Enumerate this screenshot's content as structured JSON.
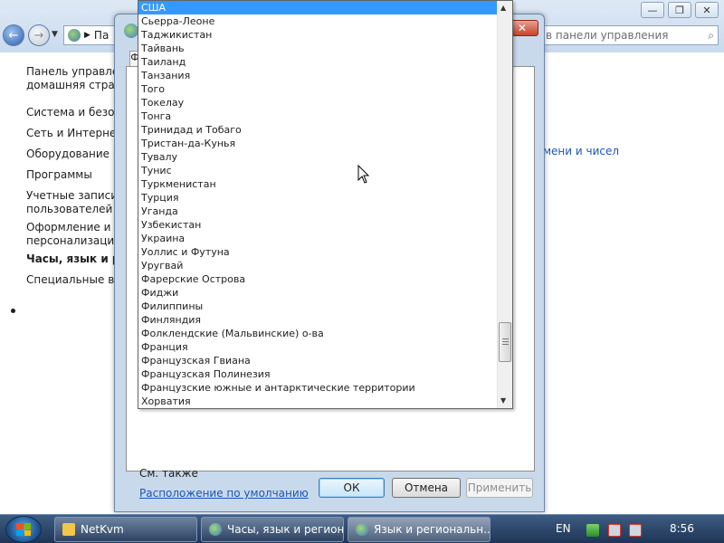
{
  "control_panel": {
    "address": "Па",
    "search_placeholder": "в панели управления",
    "sidebar": [
      {
        "label": "Панель управлен",
        "active": false
      },
      {
        "label": "домашняя страни",
        "active": false
      },
      {
        "label": "Система и безопа",
        "active": false
      },
      {
        "label": "Сеть и Интернет",
        "active": false
      },
      {
        "label": "Оборудование и з",
        "active": false
      },
      {
        "label": "Программы",
        "active": false
      },
      {
        "label": "Учетные записи",
        "active": false
      },
      {
        "label": "пользователей",
        "active": false
      },
      {
        "label": "Оформление и",
        "active": false
      },
      {
        "label": "персонализация",
        "active": false
      },
      {
        "label": "Часы, язык и рег",
        "active": true
      },
      {
        "label": "Специальные воз",
        "active": false
      }
    ],
    "right_link": "мени и чисел"
  },
  "dialog": {
    "close_glyph": "✕",
    "tab_glyph": "Ф",
    "see_also": "См. также",
    "default_location_link": "Расположение по умолчанию",
    "ok_label": "ОК",
    "cancel_label": "Отмена",
    "apply_label": "Применить"
  },
  "dropdown": {
    "selected": "США",
    "items": [
      "США",
      "Сьерра-Леоне",
      "Таджикистан",
      "Тайвань",
      "Таиланд",
      "Танзания",
      "Того",
      "Токелау",
      "Тонга",
      "Тринидад и Тобаго",
      "Тристан-да-Кунья",
      "Тувалу",
      "Тунис",
      "Туркменистан",
      "Турция",
      "Уганда",
      "Узбекистан",
      "Украина",
      "Уоллис и Футуна",
      "Уругвай",
      "Фарерские Острова",
      "Фиджи",
      "Филиппины",
      "Финляндия",
      "Фолклендские (Мальвинские) о-ва",
      "Франция",
      "Французская Гвиана",
      "Французская Полинезия",
      "Французские южные и антарктические территории",
      "Хорватия"
    ]
  },
  "taskbar": {
    "items": [
      {
        "label": "NetKvm",
        "icon": "folder-icon",
        "active": false
      },
      {
        "label": "Часы, язык и регион",
        "icon": "control-panel-icon",
        "active": false
      },
      {
        "label": "Язык и региональн...",
        "icon": "control-panel-icon",
        "active": true
      }
    ],
    "language": "EN",
    "clock": "8:56"
  },
  "colors": {
    "selection": "#3399ff",
    "link": "#1a56b5",
    "taskbar": "#1f3556"
  }
}
